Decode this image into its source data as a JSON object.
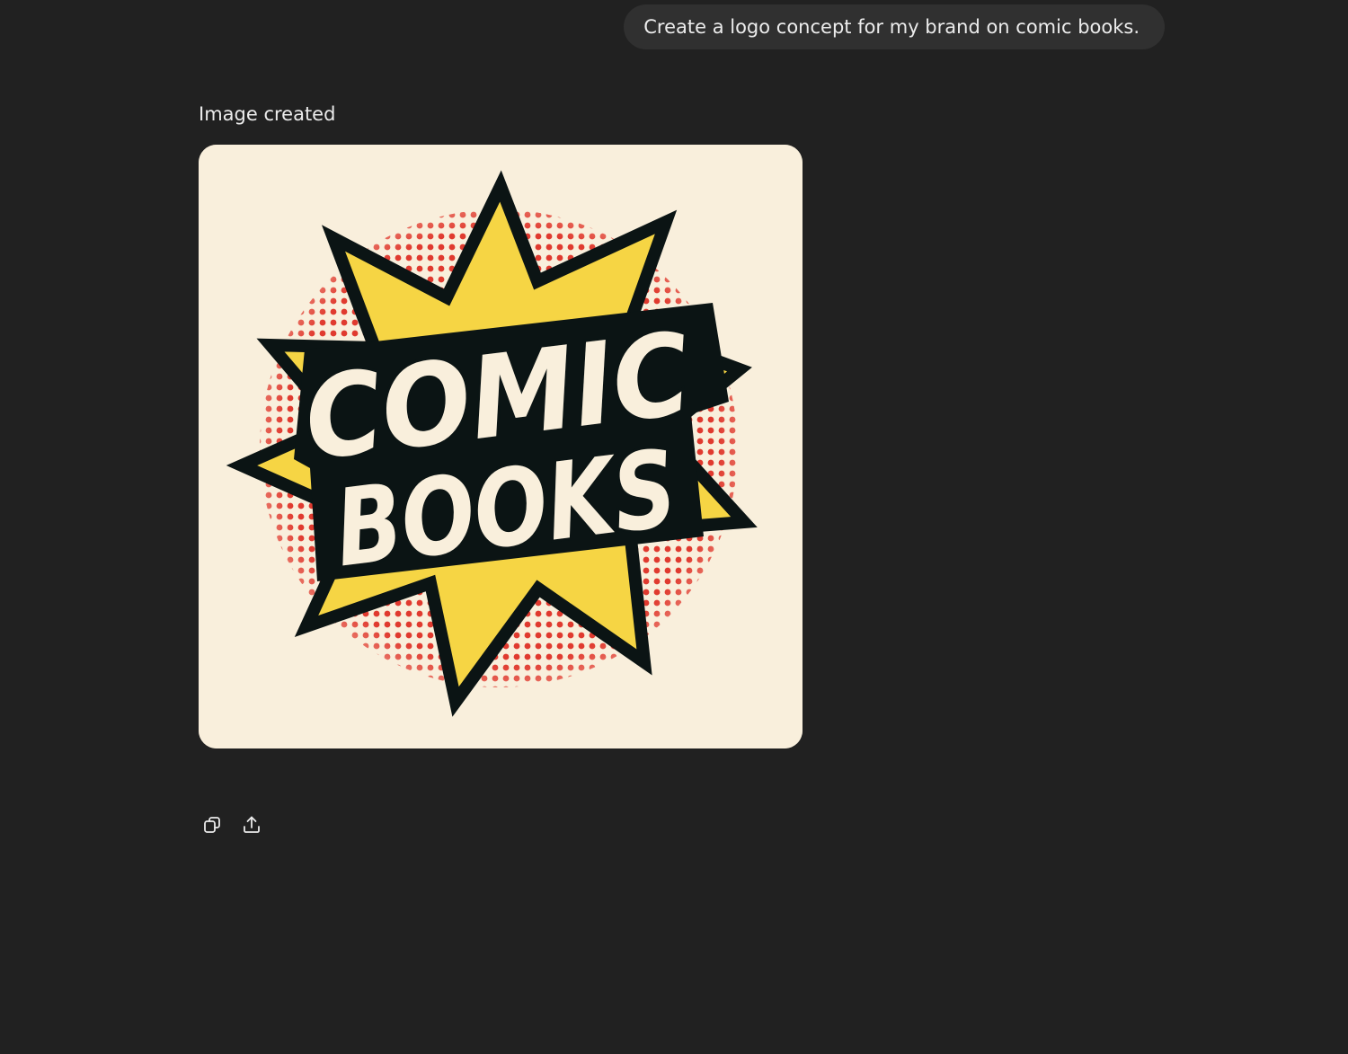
{
  "user_message": {
    "text": "Create a logo concept for my brand on comic books."
  },
  "assistant": {
    "status_label": "Image created",
    "image": {
      "logo_text_line1": "COMIC",
      "logo_text_line2": "BOOKS",
      "colors": {
        "background": "#f9efdc",
        "burst_fill": "#f6d544",
        "halftone": "#e03a2f",
        "outline": "#0b1414",
        "lettering": "#f9efdc"
      }
    },
    "actions": [
      {
        "name": "copy-icon",
        "label": "Copy"
      },
      {
        "name": "share-icon",
        "label": "Share"
      }
    ]
  },
  "theme": {
    "background": "#212121",
    "bubble": "#303030",
    "text": "#ececec"
  }
}
